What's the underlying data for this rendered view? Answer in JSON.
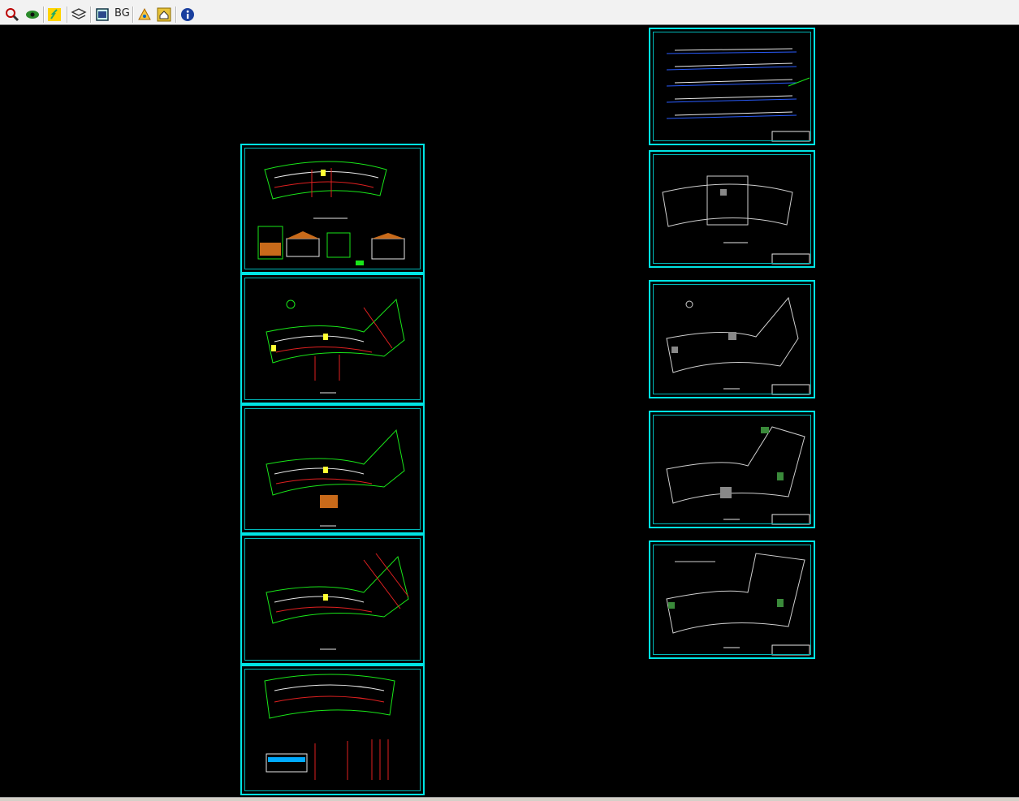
{
  "toolbar": {
    "bg_label": "BG",
    "icons": [
      "zoom-icon",
      "eye-icon",
      "lightning-icon",
      "layers-icon",
      "window-icon",
      "tools-icon",
      "home-icon",
      "info-icon"
    ]
  },
  "colors": {
    "canvas": "#000000",
    "frame": "#00e5e5",
    "green": "#19e619",
    "red": "#e02020",
    "white": "#e8e8e8",
    "yellow": "#ffff33"
  },
  "sheets": {
    "left_column_count": 5,
    "right_column_count": 5
  }
}
